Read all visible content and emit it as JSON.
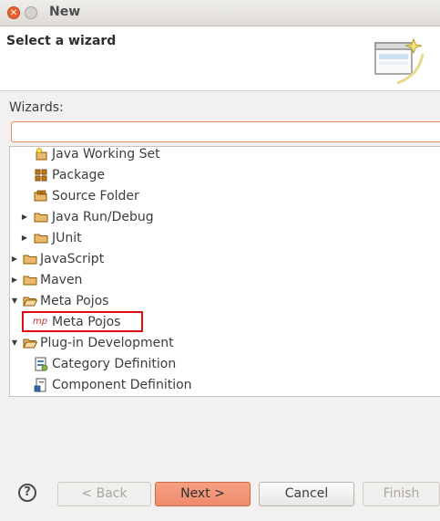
{
  "window": {
    "title": "New"
  },
  "header": {
    "title": "Select a wizard"
  },
  "wizards_label": "Wizards:",
  "filter": {
    "value": ""
  },
  "tree": {
    "items": [
      {
        "label": "Java Working Set",
        "icon": "working-set-icon"
      },
      {
        "label": "Package",
        "icon": "package-icon"
      },
      {
        "label": "Source Folder",
        "icon": "source-folder-icon"
      },
      {
        "label": "Java Run/Debug",
        "icon": "folder-icon",
        "expanded": false
      },
      {
        "label": "JUnit",
        "icon": "folder-icon",
        "expanded": false
      },
      {
        "label": "JavaScript",
        "icon": "folder-icon",
        "expanded": false
      },
      {
        "label": "Maven",
        "icon": "folder-icon",
        "expanded": false
      },
      {
        "label": "Meta Pojos",
        "icon": "folder-icon",
        "expanded": true
      },
      {
        "label": "Meta Pojos",
        "icon": "meta-pojo-icon",
        "icon_text": "mp",
        "selected": true
      },
      {
        "label": "Plug-in Development",
        "icon": "folder-icon",
        "expanded": true
      },
      {
        "label": "Category Definition",
        "icon": "category-icon"
      },
      {
        "label": "Component Definition",
        "icon": "component-icon"
      }
    ]
  },
  "buttons": {
    "help": "?",
    "back": "< Back",
    "next": "Next >",
    "cancel": "Cancel",
    "finish": "Finish"
  },
  "colors": {
    "highlight_box": "#e20b10",
    "next_button": "#ee8c6c",
    "close_button": "#e8602d",
    "folder": "#e9b96e"
  }
}
